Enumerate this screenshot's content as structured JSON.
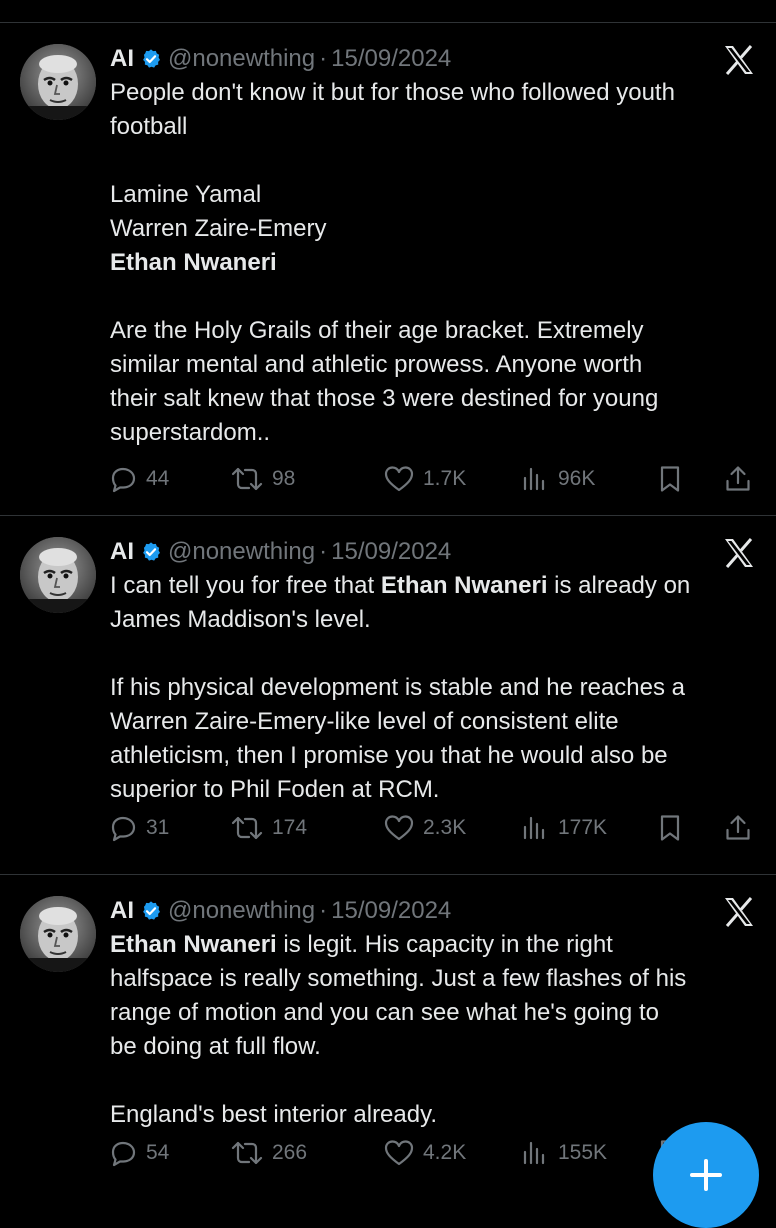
{
  "tweets": [
    {
      "name": "AI",
      "handle": "@nonewthing",
      "separator": "·",
      "date": "15/09/2024",
      "lines": [
        {
          "parts": [
            {
              "text": "People don't know it but for those who followed youth",
              "bold": false
            }
          ]
        },
        {
          "parts": [
            {
              "text": "football",
              "bold": false
            }
          ]
        },
        {
          "parts": []
        },
        {
          "parts": [
            {
              "text": "Lamine Yamal",
              "bold": false
            }
          ]
        },
        {
          "parts": [
            {
              "text": "Warren Zaire-Emery",
              "bold": false
            }
          ]
        },
        {
          "parts": [
            {
              "text": "Ethan Nwaneri",
              "bold": true
            }
          ]
        },
        {
          "parts": []
        },
        {
          "parts": [
            {
              "text": "Are the Holy Grails of their age bracket. Extremely",
              "bold": false
            }
          ]
        },
        {
          "parts": [
            {
              "text": "similar mental and athletic prowess. Anyone worth",
              "bold": false
            }
          ]
        },
        {
          "parts": [
            {
              "text": "their salt knew that those 3 were destined for young",
              "bold": false
            }
          ]
        },
        {
          "parts": [
            {
              "text": "superstardom..",
              "bold": false
            }
          ]
        }
      ],
      "stats": {
        "replies": "44",
        "reposts": "98",
        "likes": "1.7K",
        "views": "96K"
      }
    },
    {
      "name": "AI",
      "handle": "@nonewthing",
      "separator": "·",
      "date": "15/09/2024",
      "lines": [
        {
          "parts": [
            {
              "text": "I can tell you for free that ",
              "bold": false
            },
            {
              "text": "Ethan Nwaneri",
              "bold": true
            },
            {
              "text": " is already on",
              "bold": false
            }
          ]
        },
        {
          "parts": [
            {
              "text": "James Maddison's level.",
              "bold": false
            }
          ]
        },
        {
          "parts": []
        },
        {
          "parts": [
            {
              "text": "If his physical development is stable and he reaches a",
              "bold": false
            }
          ]
        },
        {
          "parts": [
            {
              "text": "Warren Zaire-Emery-like level of consistent elite",
              "bold": false
            }
          ]
        },
        {
          "parts": [
            {
              "text": "athleticism, then I promise you that he would also be",
              "bold": false
            }
          ]
        },
        {
          "parts": [
            {
              "text": "superior to Phil Foden at RCM.",
              "bold": false
            }
          ]
        }
      ],
      "stats": {
        "replies": "31",
        "reposts": "174",
        "likes": "2.3K",
        "views": "177K"
      }
    },
    {
      "name": "AI",
      "handle": "@nonewthing",
      "separator": "·",
      "date": "15/09/2024",
      "lines": [
        {
          "parts": [
            {
              "text": "Ethan Nwaneri",
              "bold": true
            },
            {
              "text": " is legit. His capacity in the right",
              "bold": false
            }
          ]
        },
        {
          "parts": [
            {
              "text": "halfspace is really something. Just a few flashes of his",
              "bold": false
            }
          ]
        },
        {
          "parts": [
            {
              "text": "range of motion and you can see what he's going to",
              "bold": false
            }
          ]
        },
        {
          "parts": [
            {
              "text": "be doing at full flow.",
              "bold": false
            }
          ]
        },
        {
          "parts": []
        },
        {
          "parts": [
            {
              "text": "England's best interior already.",
              "bold": false
            }
          ]
        }
      ],
      "stats": {
        "replies": "54",
        "reposts": "266",
        "likes": "4.2K",
        "views": "155K"
      }
    }
  ],
  "colors": {
    "background": "#000000",
    "text": "#e7e9ea",
    "muted": "#71767b",
    "divider": "#2f3336",
    "accent": "#1d9bf0"
  },
  "icons": {
    "verified": "verified-badge-icon",
    "platform": "x-logo-icon",
    "reply": "reply-icon",
    "repost": "repost-icon",
    "like": "heart-icon",
    "views": "views-icon",
    "bookmark": "bookmark-icon",
    "share": "share-icon",
    "compose": "plus-icon"
  }
}
